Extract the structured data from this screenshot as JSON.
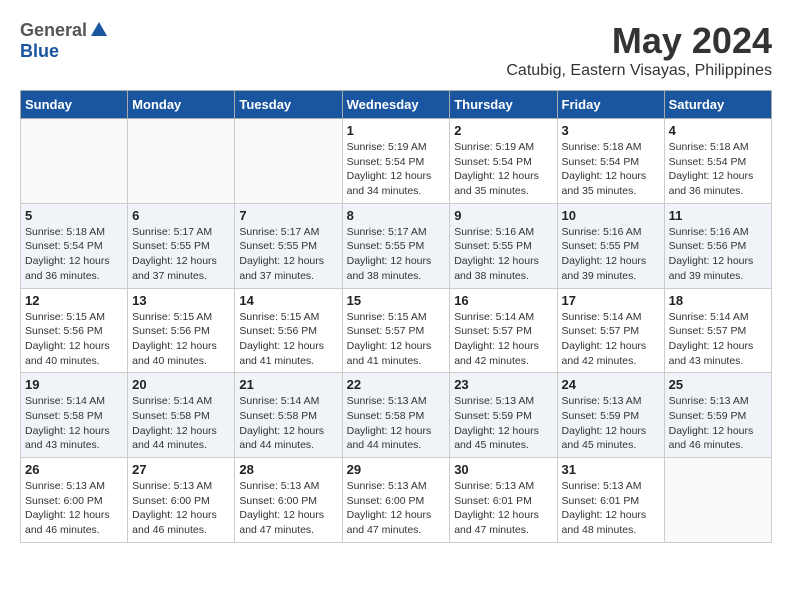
{
  "header": {
    "logo_general": "General",
    "logo_blue": "Blue",
    "main_title": "May 2024",
    "subtitle": "Catubig, Eastern Visayas, Philippines"
  },
  "days_of_week": [
    "Sunday",
    "Monday",
    "Tuesday",
    "Wednesday",
    "Thursday",
    "Friday",
    "Saturday"
  ],
  "weeks": [
    [
      {
        "day": "",
        "info": ""
      },
      {
        "day": "",
        "info": ""
      },
      {
        "day": "",
        "info": ""
      },
      {
        "day": "1",
        "info": "Sunrise: 5:19 AM\nSunset: 5:54 PM\nDaylight: 12 hours\nand 34 minutes."
      },
      {
        "day": "2",
        "info": "Sunrise: 5:19 AM\nSunset: 5:54 PM\nDaylight: 12 hours\nand 35 minutes."
      },
      {
        "day": "3",
        "info": "Sunrise: 5:18 AM\nSunset: 5:54 PM\nDaylight: 12 hours\nand 35 minutes."
      },
      {
        "day": "4",
        "info": "Sunrise: 5:18 AM\nSunset: 5:54 PM\nDaylight: 12 hours\nand 36 minutes."
      }
    ],
    [
      {
        "day": "5",
        "info": "Sunrise: 5:18 AM\nSunset: 5:54 PM\nDaylight: 12 hours\nand 36 minutes."
      },
      {
        "day": "6",
        "info": "Sunrise: 5:17 AM\nSunset: 5:55 PM\nDaylight: 12 hours\nand 37 minutes."
      },
      {
        "day": "7",
        "info": "Sunrise: 5:17 AM\nSunset: 5:55 PM\nDaylight: 12 hours\nand 37 minutes."
      },
      {
        "day": "8",
        "info": "Sunrise: 5:17 AM\nSunset: 5:55 PM\nDaylight: 12 hours\nand 38 minutes."
      },
      {
        "day": "9",
        "info": "Sunrise: 5:16 AM\nSunset: 5:55 PM\nDaylight: 12 hours\nand 38 minutes."
      },
      {
        "day": "10",
        "info": "Sunrise: 5:16 AM\nSunset: 5:55 PM\nDaylight: 12 hours\nand 39 minutes."
      },
      {
        "day": "11",
        "info": "Sunrise: 5:16 AM\nSunset: 5:56 PM\nDaylight: 12 hours\nand 39 minutes."
      }
    ],
    [
      {
        "day": "12",
        "info": "Sunrise: 5:15 AM\nSunset: 5:56 PM\nDaylight: 12 hours\nand 40 minutes."
      },
      {
        "day": "13",
        "info": "Sunrise: 5:15 AM\nSunset: 5:56 PM\nDaylight: 12 hours\nand 40 minutes."
      },
      {
        "day": "14",
        "info": "Sunrise: 5:15 AM\nSunset: 5:56 PM\nDaylight: 12 hours\nand 41 minutes."
      },
      {
        "day": "15",
        "info": "Sunrise: 5:15 AM\nSunset: 5:57 PM\nDaylight: 12 hours\nand 41 minutes."
      },
      {
        "day": "16",
        "info": "Sunrise: 5:14 AM\nSunset: 5:57 PM\nDaylight: 12 hours\nand 42 minutes."
      },
      {
        "day": "17",
        "info": "Sunrise: 5:14 AM\nSunset: 5:57 PM\nDaylight: 12 hours\nand 42 minutes."
      },
      {
        "day": "18",
        "info": "Sunrise: 5:14 AM\nSunset: 5:57 PM\nDaylight: 12 hours\nand 43 minutes."
      }
    ],
    [
      {
        "day": "19",
        "info": "Sunrise: 5:14 AM\nSunset: 5:58 PM\nDaylight: 12 hours\nand 43 minutes."
      },
      {
        "day": "20",
        "info": "Sunrise: 5:14 AM\nSunset: 5:58 PM\nDaylight: 12 hours\nand 44 minutes."
      },
      {
        "day": "21",
        "info": "Sunrise: 5:14 AM\nSunset: 5:58 PM\nDaylight: 12 hours\nand 44 minutes."
      },
      {
        "day": "22",
        "info": "Sunrise: 5:13 AM\nSunset: 5:58 PM\nDaylight: 12 hours\nand 44 minutes."
      },
      {
        "day": "23",
        "info": "Sunrise: 5:13 AM\nSunset: 5:59 PM\nDaylight: 12 hours\nand 45 minutes."
      },
      {
        "day": "24",
        "info": "Sunrise: 5:13 AM\nSunset: 5:59 PM\nDaylight: 12 hours\nand 45 minutes."
      },
      {
        "day": "25",
        "info": "Sunrise: 5:13 AM\nSunset: 5:59 PM\nDaylight: 12 hours\nand 46 minutes."
      }
    ],
    [
      {
        "day": "26",
        "info": "Sunrise: 5:13 AM\nSunset: 6:00 PM\nDaylight: 12 hours\nand 46 minutes."
      },
      {
        "day": "27",
        "info": "Sunrise: 5:13 AM\nSunset: 6:00 PM\nDaylight: 12 hours\nand 46 minutes."
      },
      {
        "day": "28",
        "info": "Sunrise: 5:13 AM\nSunset: 6:00 PM\nDaylight: 12 hours\nand 47 minutes."
      },
      {
        "day": "29",
        "info": "Sunrise: 5:13 AM\nSunset: 6:00 PM\nDaylight: 12 hours\nand 47 minutes."
      },
      {
        "day": "30",
        "info": "Sunrise: 5:13 AM\nSunset: 6:01 PM\nDaylight: 12 hours\nand 47 minutes."
      },
      {
        "day": "31",
        "info": "Sunrise: 5:13 AM\nSunset: 6:01 PM\nDaylight: 12 hours\nand 48 minutes."
      },
      {
        "day": "",
        "info": ""
      }
    ]
  ]
}
